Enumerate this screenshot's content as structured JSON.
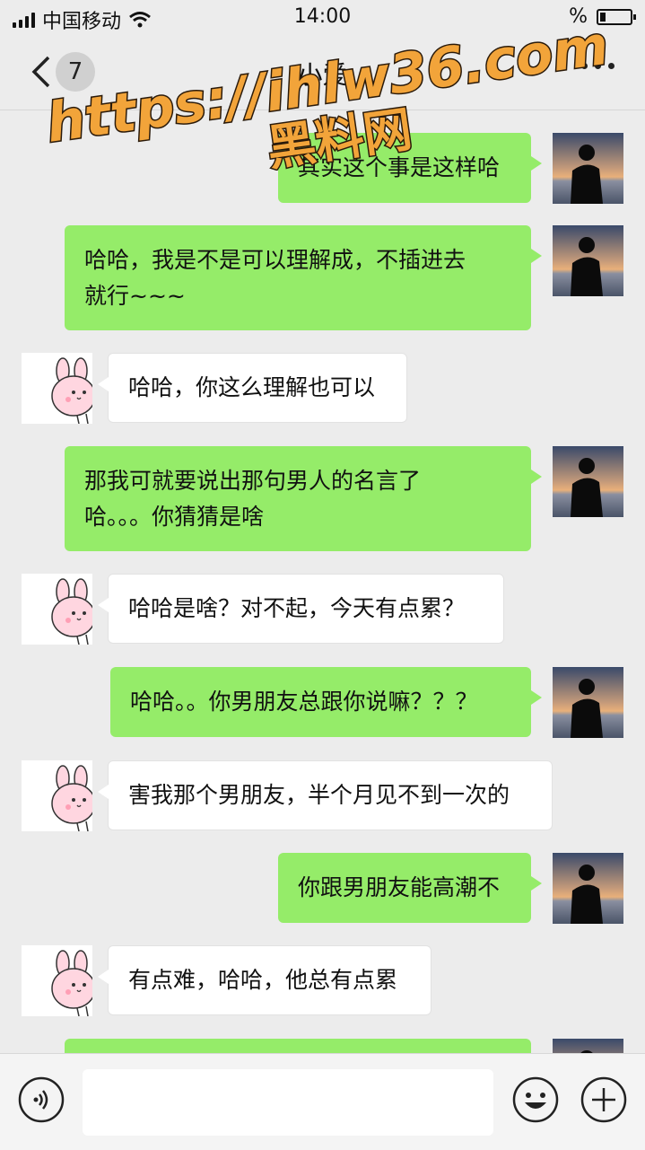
{
  "status_bar": {
    "carrier": "中国移动",
    "time": "14:00",
    "battery_percent_text": "%",
    "battery_level": 0.2
  },
  "nav": {
    "unread_count": "7",
    "title": "小爱",
    "icons": {
      "back": "chevron-left-icon",
      "more": "more-dots-icon"
    }
  },
  "watermark": {
    "line1": "https://ihlw36.com",
    "line2": "黑料网"
  },
  "messages": [
    {
      "sender": "me",
      "text": "其实这个事是这样哈"
    },
    {
      "sender": "me",
      "text": "哈哈，我是不是可以理解成，不插进去\n就行~~~"
    },
    {
      "sender": "them",
      "text": "哈哈，你这么理解也可以"
    },
    {
      "sender": "me",
      "text": "那我可就要说出那句男人的名言了\n哈。。。你猜猜是啥"
    },
    {
      "sender": "them",
      "text": "哈哈是啥？对不起，今天有点累？"
    },
    {
      "sender": "me",
      "text": "哈哈。。你男朋友总跟你说嘛？？？"
    },
    {
      "sender": "them",
      "text": "害我那个男朋友，半个月见不到一次的"
    },
    {
      "sender": "me",
      "text": "你跟男朋友能高潮不"
    },
    {
      "sender": "them",
      "text": "有点难，哈哈，他总有点累"
    },
    {
      "sender": "me",
      "text": ""
    }
  ],
  "input_bar": {
    "icons": {
      "voice": "voice-icon",
      "emoji": "emoji-icon",
      "plus": "plus-icon"
    },
    "text_value": ""
  },
  "colors": {
    "my_bubble": "#95ec69",
    "their_bubble": "#ffffff",
    "background": "#ececec"
  }
}
